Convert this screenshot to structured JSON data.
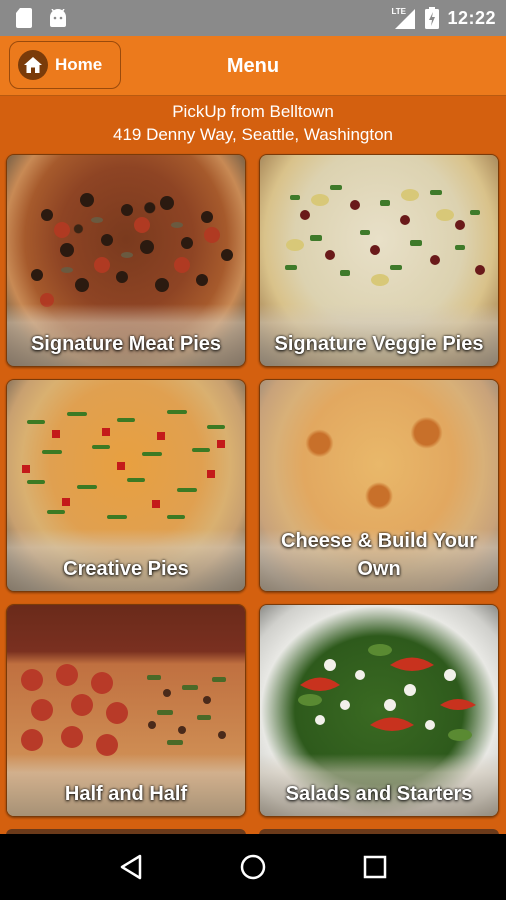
{
  "status_bar": {
    "time": "12:22",
    "network": "LTE",
    "icons": [
      "sd-card-icon",
      "android-icon",
      "signal-icon",
      "battery-icon"
    ]
  },
  "app_bar": {
    "home_label": "Home",
    "title": "Menu"
  },
  "pickup": {
    "line1": "PickUp from Belltown",
    "line2": "419 Denny Way, Seattle, Washington"
  },
  "categories": [
    {
      "label": "Signature Meat Pies"
    },
    {
      "label": "Signature Veggie Pies"
    },
    {
      "label": "Creative Pies"
    },
    {
      "label": "Cheese & Build Your Own"
    },
    {
      "label": "Half and Half"
    },
    {
      "label": "Salads and Starters"
    }
  ],
  "colors": {
    "app_bar": "#ec7a1c",
    "background": "#d4600f",
    "status_bar": "#8a8a8a",
    "nav_bar": "#000000"
  },
  "nav_bar": {
    "buttons": [
      "back-icon",
      "home-circle-icon",
      "recents-icon"
    ]
  }
}
